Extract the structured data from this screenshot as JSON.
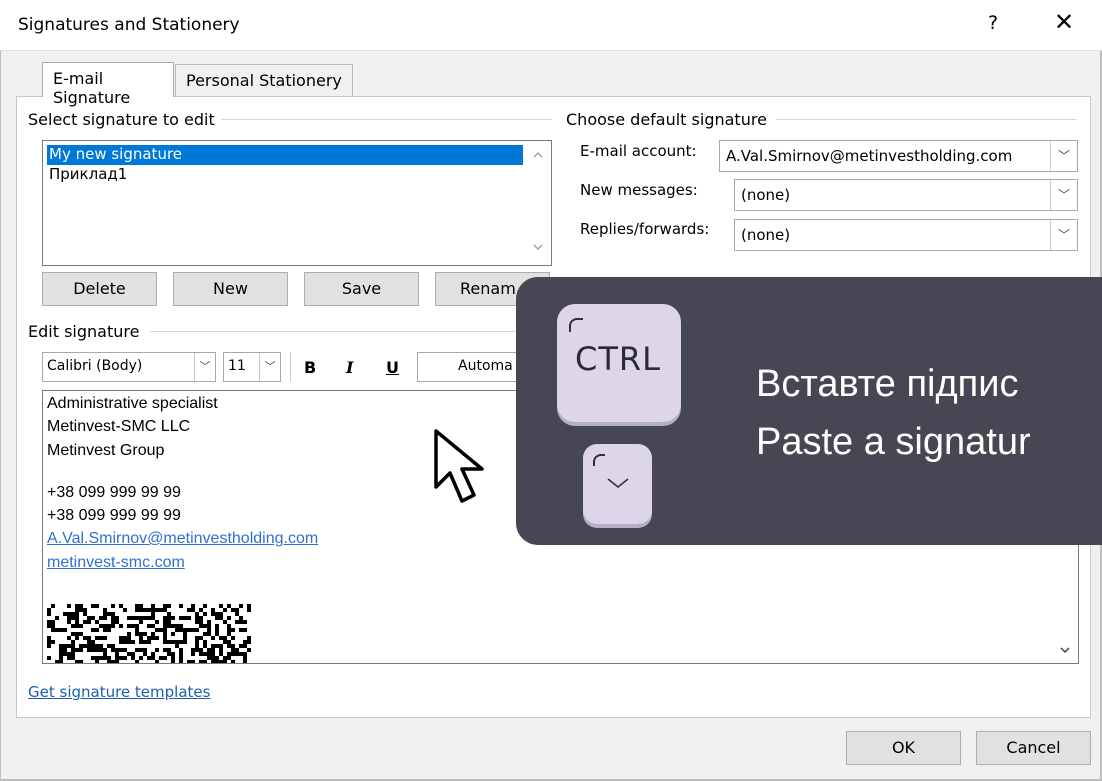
{
  "window": {
    "title": "Signatures and Stationery",
    "help": "?",
    "close": "✕"
  },
  "tabs": [
    {
      "label": "E-mail Signature",
      "underline": "E"
    },
    {
      "label": "Personal Stationery",
      "underline": "P"
    }
  ],
  "select_signature": {
    "group_label": "Select signature to edit",
    "items": [
      "My new signature",
      "Приклад1"
    ],
    "selected_index": 0
  },
  "buttons": {
    "delete": "Delete",
    "new": "New",
    "save": "Save",
    "rename": "Renam"
  },
  "default_signature": {
    "group_label": "Choose default signature",
    "email_account_label": "E-mail account:",
    "email_account_value": "A.Val.Smirnov@metinvestholding.com",
    "new_messages_label": "New messages:",
    "new_messages_value": "(none)",
    "replies_label": "Replies/forwards:",
    "replies_value": "(none)"
  },
  "edit_signature": {
    "group_label": "Edit signature",
    "font": "Calibri (Body)",
    "size": "11",
    "bold": "B",
    "italic": "I",
    "underline": "U",
    "color": "Automa"
  },
  "signature_body": {
    "lines": [
      "Administrative specialist",
      "Metinvest-SMC LLC",
      "Metinvest Group"
    ],
    "phones": [
      "+38 099 999 99 99",
      "+38 099 999 99 99"
    ],
    "email_link": "A.Val.Smirnov@metinvestholding.com",
    "site_link": "metinvest-smc.com"
  },
  "templates_link": "Get signature templates",
  "overlay": {
    "key_label": "CTRL",
    "text_line1": "Вставте підпис",
    "text_line2": "Paste a signatur"
  },
  "footer": {
    "ok": "OK",
    "cancel": "Cancel"
  },
  "colors": {
    "selection": "#0078d7",
    "link": "#2f6fd6",
    "overlay_bg": "#474753",
    "key_bg": "#dcd6e8"
  }
}
